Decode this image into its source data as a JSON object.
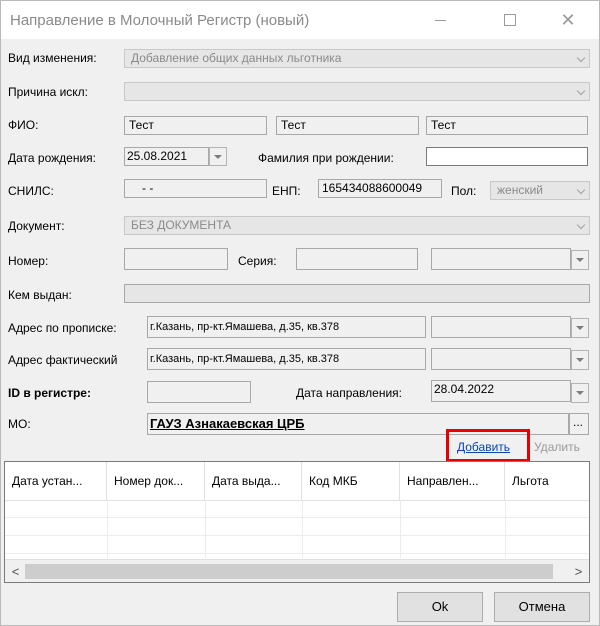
{
  "window": {
    "title": "Направление в Молочный Регистр (новый)",
    "minimize_label": "",
    "close_glyph": "✕"
  },
  "form": {
    "change_type_label": "Вид изменения:",
    "change_type_value": "Добавление общих данных льготника",
    "exclusion_reason_label": "Причина искл:",
    "exclusion_reason_value": "",
    "fio_label": "ФИО:",
    "last_name": "Тест",
    "first_name": "Тест",
    "middle_name": "Тест",
    "birth_date_label": "Дата рождения:",
    "birth_date": "25.08.2021",
    "birth_surname_label": "Фамилия при рождении:",
    "birth_surname": "",
    "snils_label": "СНИЛС:",
    "snils": "-  -",
    "enp_label": "ЕНП:",
    "enp": "165434088600049",
    "gender_label": "Пол:",
    "gender": "женский",
    "document_label": "Документ:",
    "document": "БЕЗ ДОКУМЕНТА",
    "number_label": "Номер:",
    "number": "",
    "series_label": "Серия:",
    "series": "",
    "issued_by_label": "Кем выдан:",
    "issued_by": "",
    "reg_address_label": "Адрес по прописке:",
    "reg_address": "г.Казань, пр-кт.Ямашева, д.35, кв.378",
    "actual_address_label": "Адрес фактический",
    "actual_address": "г.Казань, пр-кт.Ямашева, д.35, кв.378",
    "registry_id_label": "ID в регистре:",
    "registry_id": "",
    "referral_date_label": "Дата направления:",
    "referral_date": "28.04.2022",
    "mo_label": "МО:",
    "mo": "ГАУЗ Азнакаевская ЦРБ",
    "mo_browse": "..."
  },
  "actions": {
    "add": "Добавить",
    "delete": "Удалить"
  },
  "grid": {
    "columns": [
      "Дата устан...",
      "Номер док...",
      "Дата выда...",
      "Код МКБ",
      "Направлен...",
      "Льгота"
    ],
    "scroll_left": "<",
    "scroll_right": ">"
  },
  "buttons": {
    "ok": "Ok",
    "cancel": "Отмена"
  },
  "colors": {
    "highlight": "#e80000",
    "link": "#0645ad"
  }
}
